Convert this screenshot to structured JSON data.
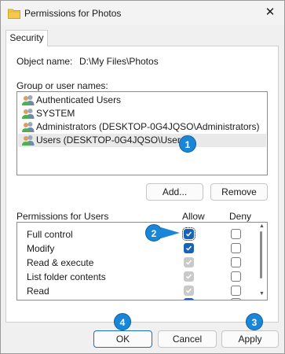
{
  "window": {
    "title": "Permissions for Photos",
    "close_glyph": "✕"
  },
  "tabs": [
    {
      "label": "Security",
      "selected": true
    }
  ],
  "object_name": {
    "label": "Object name:",
    "value": "D:\\My Files\\Photos"
  },
  "group": {
    "label": "Group or user names:",
    "items": [
      {
        "label": "Authenticated Users",
        "icon": "users-group-icon",
        "selected": false
      },
      {
        "label": "SYSTEM",
        "icon": "users-group-icon",
        "selected": false
      },
      {
        "label": "Administrators (DESKTOP-0G4JQSO\\Administrators)",
        "icon": "users-group-icon",
        "selected": false
      },
      {
        "label": "Users (DESKTOP-0G4JQSO\\Users)",
        "icon": "users-group-icon",
        "selected": true
      }
    ]
  },
  "buttons": {
    "add": "Add...",
    "remove": "Remove",
    "ok": "OK",
    "cancel": "Cancel",
    "apply": "Apply"
  },
  "permissions": {
    "label": "Permissions for Users",
    "allow_header": "Allow",
    "deny_header": "Deny",
    "rows": [
      {
        "name": "Full control",
        "allow": "checked",
        "deny": "unchecked"
      },
      {
        "name": "Modify",
        "allow": "checked",
        "deny": "unchecked"
      },
      {
        "name": "Read & execute",
        "allow": "inherited-checked",
        "deny": "unchecked"
      },
      {
        "name": "List folder contents",
        "allow": "inherited-checked",
        "deny": "unchecked"
      },
      {
        "name": "Read",
        "allow": "inherited-checked",
        "deny": "unchecked"
      },
      {
        "name": "",
        "allow": "checked",
        "deny": "unchecked"
      }
    ]
  },
  "badges": [
    "1",
    "2",
    "3",
    "4"
  ],
  "colors": {
    "accent": "#1a62b8",
    "badge": "#1a86d8",
    "folder": "#f2c94c"
  }
}
